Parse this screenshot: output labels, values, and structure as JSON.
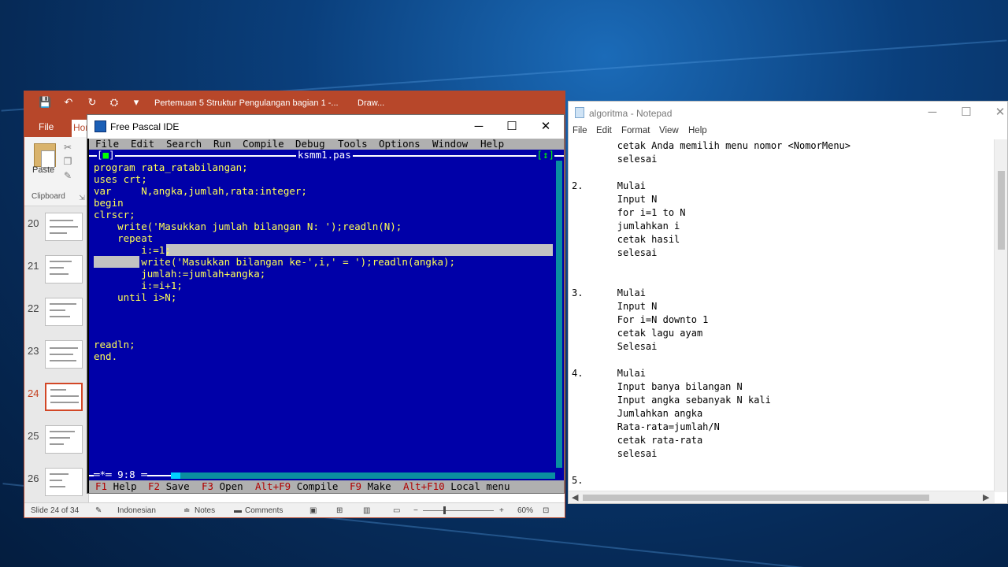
{
  "powerpoint": {
    "title": "Pertemuan 5 Struktur Pengulangan bagian 1 -...",
    "context_tab": "Draw...",
    "tab_file": "File",
    "tab_home": "Hor",
    "paste_label": "Paste",
    "clipboard_label": "Clipboard",
    "slide_numbers": [
      "20",
      "21",
      "22",
      "23",
      "24",
      "25",
      "26"
    ],
    "active_slide": "24",
    "status": {
      "slide": "Slide 24 of 34",
      "language": "Indonesian",
      "notes": "Notes",
      "comments": "Comments",
      "zoom": "60%"
    },
    "accent": "#b7472a"
  },
  "pascal": {
    "title": "Free Pascal IDE",
    "menu": [
      "File",
      "Edit",
      "Search",
      "Run",
      "Compile",
      "Debug",
      "Tools",
      "Options",
      "Window",
      "Help"
    ],
    "file_name": "ksmm1.pas",
    "close_box": "[■]",
    "zoom_box": "[↕]",
    "cursor_pos": "═*═ 9:8 ═",
    "code": [
      "program rata_ratabilangan;",
      "uses crt;",
      "var     N,angka,jumlah,rata:integer;",
      "begin",
      "clrscr;",
      "    write('Masukkan jumlah bilangan N: ');readln(N);",
      "    repeat",
      "        i:=1;",
      "        write('Masukkan bilangan ke-',i,' = ');readln(angka);",
      "        jumlah:=jumlah+angka;",
      "        i:=i+1;",
      "    until i>N;",
      "",
      "",
      "",
      "readln;",
      "end."
    ],
    "fkeys": [
      {
        "key": "F1",
        "label": "Help"
      },
      {
        "key": "F2",
        "label": "Save"
      },
      {
        "key": "F3",
        "label": "Open"
      },
      {
        "key": "Alt+F9",
        "label": "Compile"
      },
      {
        "key": "F9",
        "label": "Make"
      },
      {
        "key": "Alt+F10",
        "label": "Local menu"
      }
    ],
    "editor_bg": "#0000a8"
  },
  "notepad": {
    "title": "algoritma - Notepad",
    "menu": [
      "File",
      "Edit",
      "Format",
      "View",
      "Help"
    ],
    "lines": [
      "        cetak Anda memilih menu nomor <NomorMenu>",
      "        selesai",
      "",
      "2.      Mulai",
      "        Input N",
      "        for i=1 to N",
      "        jumlahkan i",
      "        cetak hasil",
      "        selesai",
      "",
      "",
      "3.      Mulai",
      "        Input N",
      "        For i=N downto 1",
      "        cetak lagu ayam",
      "        Selesai",
      "",
      "4.      Mulai",
      "        Input banya bilangan N",
      "        Input angka sebanyak N kali",
      "        Jumlahkan angka",
      "        Rata-rata=jumlah/N",
      "        cetak rata-rata",
      "        selesai",
      "",
      "5."
    ]
  }
}
